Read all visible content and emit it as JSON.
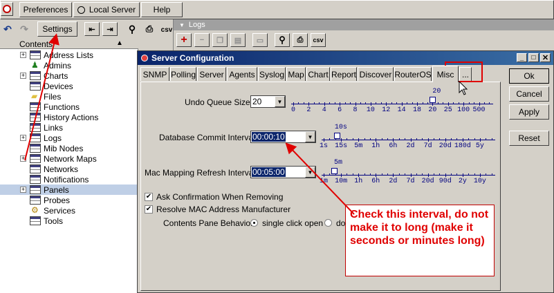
{
  "menubar": {
    "preferences": "Preferences",
    "local_server": "Local Server",
    "help": "Help"
  },
  "toolbar": {
    "settings": "Settings",
    "csv": "csv"
  },
  "tree": {
    "header": "Contents",
    "items": [
      {
        "label": "Address Lists",
        "expandable": true,
        "icon": "table-icon"
      },
      {
        "label": "Admins",
        "expandable": false,
        "icon": "admin-user-icon"
      },
      {
        "label": "Charts",
        "expandable": true,
        "icon": "table-icon"
      },
      {
        "label": "Devices",
        "expandable": false,
        "icon": "table-icon"
      },
      {
        "label": "Files",
        "expandable": false,
        "icon": "folder-icon"
      },
      {
        "label": "Functions",
        "expandable": false,
        "icon": "table-icon"
      },
      {
        "label": "History Actions",
        "expandable": false,
        "icon": "table-icon"
      },
      {
        "label": "Links",
        "expandable": false,
        "icon": "table-icon"
      },
      {
        "label": "Logs",
        "expandable": true,
        "icon": "table-icon"
      },
      {
        "label": "Mib Nodes",
        "expandable": false,
        "icon": "table-icon"
      },
      {
        "label": "Network Maps",
        "expandable": true,
        "icon": "table-icon"
      },
      {
        "label": "Networks",
        "expandable": false,
        "icon": "table-icon"
      },
      {
        "label": "Notifications",
        "expandable": false,
        "icon": "table-icon"
      },
      {
        "label": "Panels",
        "expandable": true,
        "icon": "table-icon",
        "selected": true
      },
      {
        "label": "Probes",
        "expandable": false,
        "icon": "table-icon"
      },
      {
        "label": "Services",
        "expandable": false,
        "icon": "gear-icon"
      },
      {
        "label": "Tools",
        "expandable": false,
        "icon": "table-icon"
      }
    ]
  },
  "logs_panel": {
    "title": "Logs",
    "csv": "csv"
  },
  "dialog": {
    "title": "Server Configuration",
    "tabs": [
      "SNMP",
      "Polling",
      "Server",
      "Agents",
      "Syslog",
      "Map",
      "Chart",
      "Report",
      "Discover",
      "RouterOS",
      "Misc",
      "..."
    ],
    "active_tab": "Misc",
    "fields": {
      "undo_label": "Undo Queue Size:",
      "undo_value": "20",
      "undo_slider_value": "20",
      "undo_scale": [
        "0",
        "2",
        "4",
        "6",
        "8",
        "10",
        "12",
        "14",
        "18",
        "20",
        "25",
        "100",
        "500"
      ],
      "db_label": "Database Commit Interval:",
      "db_value": "00:00:10",
      "db_slider_value": "10s",
      "db_scale": [
        "1s",
        "15s",
        "5m",
        "1h",
        "6h",
        "2d",
        "7d",
        "20d",
        "180d",
        "5y"
      ],
      "mac_label": "Mac Mapping Refresh Interval:",
      "mac_value": "00:05:00",
      "mac_slider_value": "5m",
      "mac_scale": [
        "1m",
        "10m",
        "1h",
        "6h",
        "2d",
        "7d",
        "20d",
        "90d",
        "2y",
        "10y"
      ],
      "ask_confirm": "Ask Confirmation When Removing",
      "resolve_mac": "Resolve MAC Address Manufacturer",
      "contents_behavior_label": "Contents Pane Behavior:",
      "single_click": "single click open",
      "double_click_partial": "do"
    },
    "buttons": {
      "ok": "Ok",
      "cancel": "Cancel",
      "apply": "Apply",
      "reset": "Reset"
    }
  },
  "annotation": {
    "text": "Check this interval, do not make it to long (make it seconds or minutes long)",
    "color": "#e00000"
  }
}
